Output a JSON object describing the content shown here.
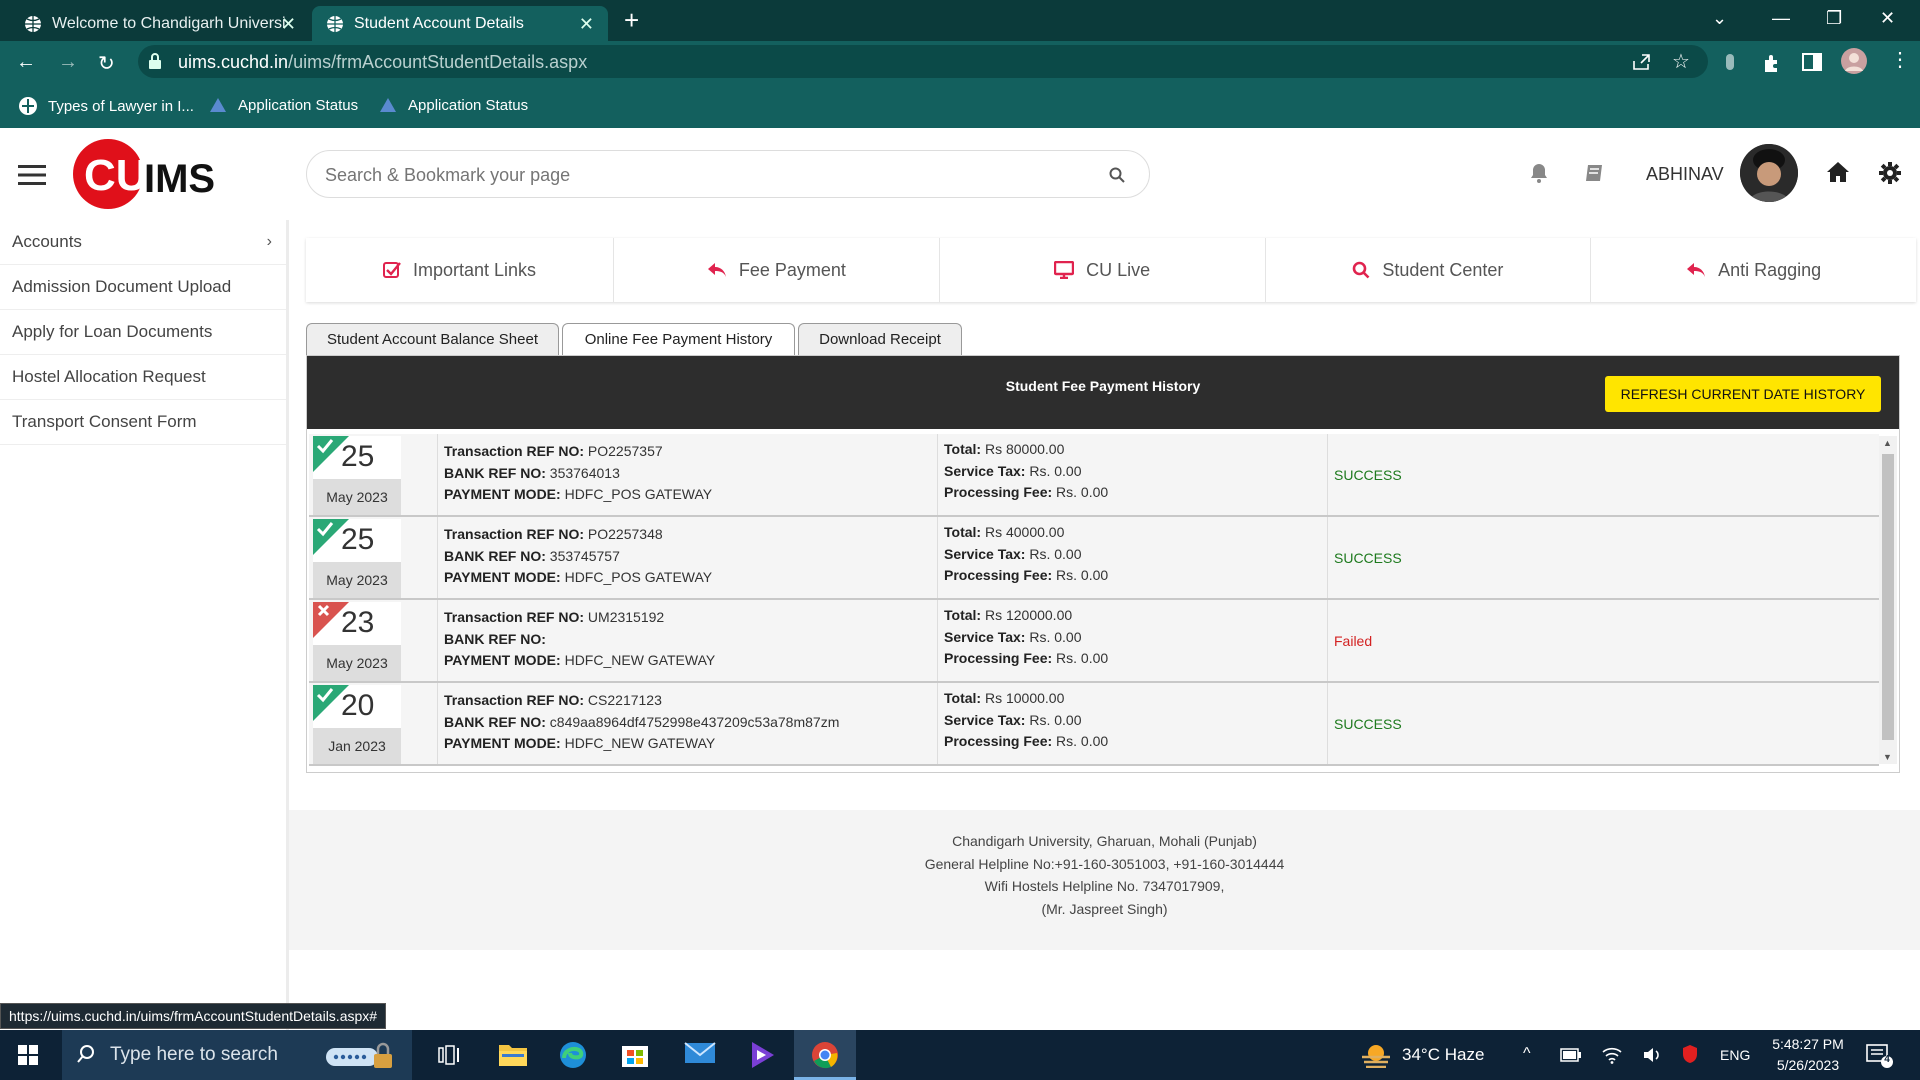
{
  "browser": {
    "tabs": [
      {
        "title": "Welcome to Chandigarh Universi",
        "active": false
      },
      {
        "title": "Student Account Details",
        "active": true
      }
    ],
    "url_host": "uims.cuchd.in",
    "url_path": "/uims/frmAccountStudentDetails.aspx",
    "bookmarks": [
      "Types of Lawyer in I...",
      "Application Status",
      "Application Status"
    ]
  },
  "header": {
    "logo_text": "CUIMS",
    "search_placeholder": "Search & Bookmark your page",
    "username": "ABHINAV"
  },
  "sidebar": {
    "items": [
      {
        "label": "Accounts",
        "has_submenu": true
      },
      {
        "label": "Admission Document Upload"
      },
      {
        "label": "Apply for Loan Documents"
      },
      {
        "label": "Hostel Allocation Request"
      },
      {
        "label": "Transport Consent Form"
      }
    ]
  },
  "quick_links": [
    "Important Links",
    "Fee Payment",
    "CU Live",
    "Student Center",
    "Anti Ragging"
  ],
  "page_tabs": [
    "Student Account Balance Sheet",
    "Online Fee Payment History",
    "Download Receipt"
  ],
  "active_tab": "Online Fee Payment History",
  "panel": {
    "title": "Student Fee Payment History",
    "refresh_label": "REFRESH CURRENT DATE HISTORY",
    "labels": {
      "txn": "Transaction REF NO:",
      "bank": "BANK REF NO:",
      "mode": "PAYMENT MODE:",
      "total": "Total:",
      "tax": "Service Tax:",
      "fee": "Processing Fee:"
    },
    "transactions": [
      {
        "day": "25",
        "month": "May 2023",
        "ok": true,
        "txn": "PO2257357",
        "bank": "353764013",
        "mode": "HDFC_POS GATEWAY",
        "total": "Rs 80000.00",
        "tax": "Rs. 0.00",
        "fee": "Rs. 0.00",
        "status": "SUCCESS"
      },
      {
        "day": "25",
        "month": "May 2023",
        "ok": true,
        "txn": "PO2257348",
        "bank": "353745757",
        "mode": "HDFC_POS GATEWAY",
        "total": "Rs 40000.00",
        "tax": "Rs. 0.00",
        "fee": "Rs. 0.00",
        "status": "SUCCESS"
      },
      {
        "day": "23",
        "month": "May 2023",
        "ok": false,
        "txn": "UM2315192",
        "bank": "",
        "mode": "HDFC_NEW GATEWAY",
        "total": "Rs 120000.00",
        "tax": "Rs. 0.00",
        "fee": "Rs. 0.00",
        "status": "Failed"
      },
      {
        "day": "20",
        "month": "Jan 2023",
        "ok": true,
        "txn": "CS2217123",
        "bank": "c849aa8964df4752998e437209c53a78m87zm",
        "mode": "HDFC_NEW GATEWAY",
        "total": "Rs 10000.00",
        "tax": "Rs. 0.00",
        "fee": "Rs. 0.00",
        "status": "SUCCESS"
      }
    ]
  },
  "footer": {
    "lines": [
      "Chandigarh University, Gharuan, Mohali (Punjab)",
      "General Helpline No:+91-160-3051003, +91-160-3014444",
      "Wifi Hostels Helpline No. 7347017909,",
      "(Mr. Jaspreet Singh)"
    ]
  },
  "status_url": "https://uims.cuchd.in/uims/frmAccountStudentDetails.aspx#",
  "taskbar": {
    "search_placeholder": "Type here to search",
    "weather": "34°C  Haze",
    "lang": "ENG",
    "time": "5:48:27 PM",
    "date": "5/26/2023",
    "notif_count": "4"
  },
  "colors": {
    "browser_dark": "#0b3a3a",
    "browser_teal": "#13605e",
    "accent_pink": "#e0234e",
    "refresh_yellow": "#ffe500",
    "success_green": "#1e7a1e",
    "failed_red": "#d32222"
  }
}
